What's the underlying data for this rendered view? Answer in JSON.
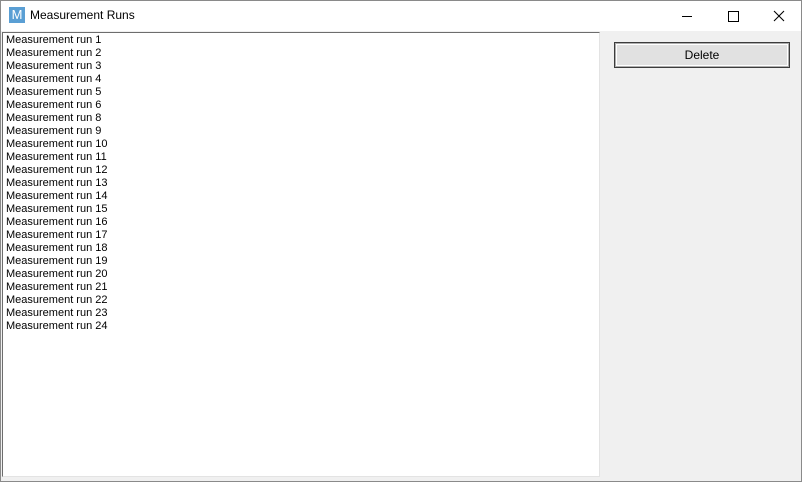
{
  "window": {
    "title": "Measurement Runs",
    "icon_letter": "M"
  },
  "list": {
    "items": [
      "Measurement run 1",
      "Measurement run 2",
      "Measurement run 3",
      "Measurement run 4",
      "Measurement run 5",
      "Measurement run 6",
      "Measurement run 8",
      "Measurement run 9",
      "Measurement run 10",
      "Measurement run 11",
      "Measurement run 12",
      "Measurement run 13",
      "Measurement run 14",
      "Measurement run 15",
      "Measurement run 16",
      "Measurement run 17",
      "Measurement run 18",
      "Measurement run 19",
      "Measurement run 20",
      "Measurement run 21",
      "Measurement run 22",
      "Measurement run 23",
      "Measurement run 24"
    ]
  },
  "actions": {
    "delete_label": "Delete"
  },
  "icons": {
    "app": "app-logo-icon",
    "minimize": "minimize-icon",
    "maximize": "maximize-icon",
    "close": "close-icon"
  },
  "colors": {
    "app_icon": "#5a9fd4",
    "panel": "#f0f0f0",
    "button": "#e1e1e1"
  }
}
